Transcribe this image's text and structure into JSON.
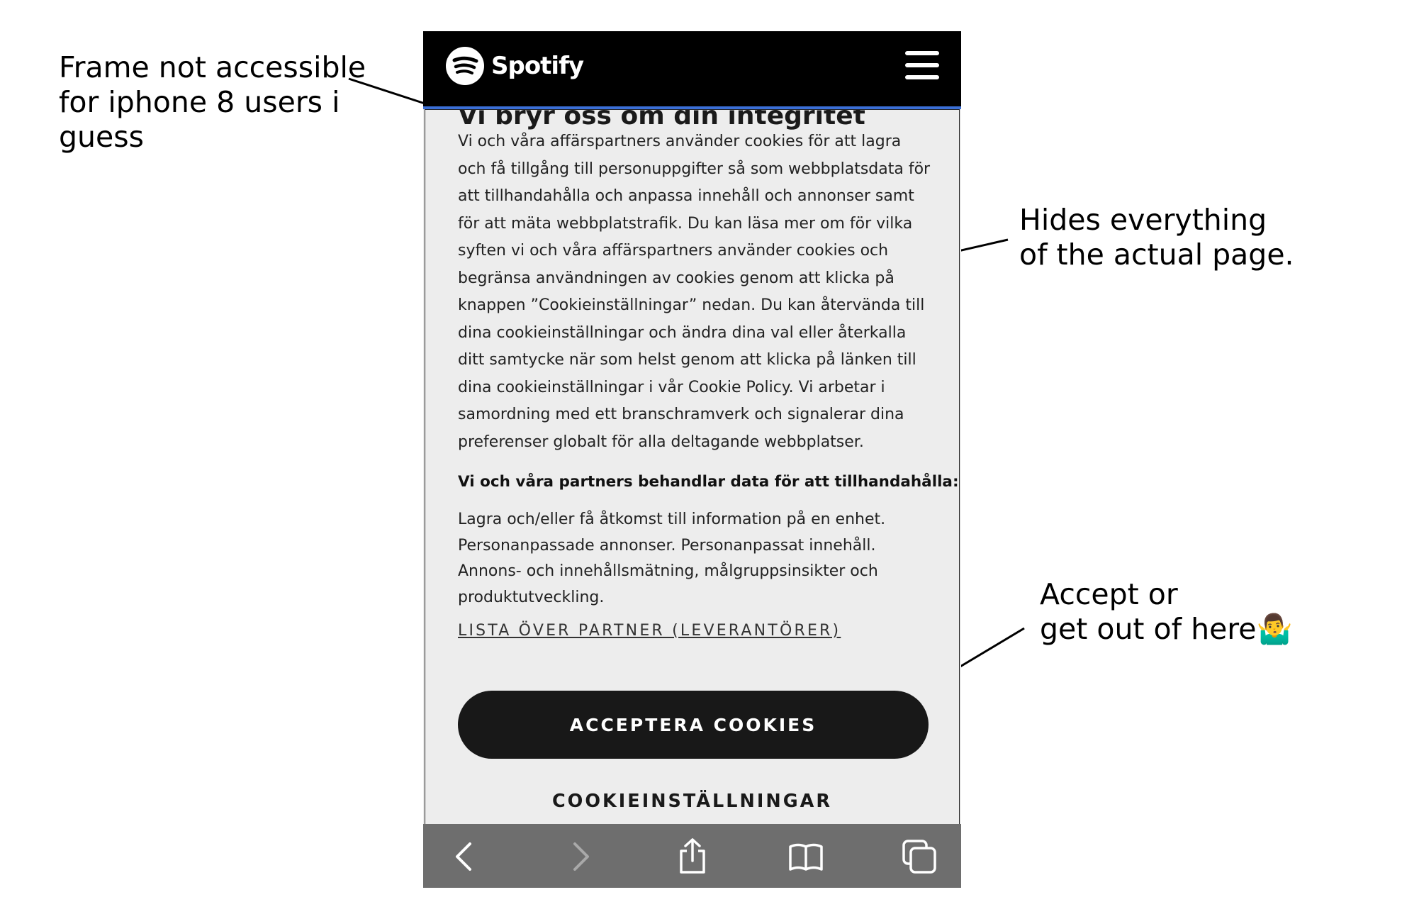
{
  "annotations": {
    "frame_note": [
      "Frame not accessible",
      "for iphone 8 users i",
      "guess"
    ],
    "hides_note": [
      "Hides everything",
      "of the actual page."
    ],
    "accept_note": [
      "Accept or",
      "get out of here🤷‍♂️"
    ]
  },
  "header": {
    "brand": "Spotify",
    "menu_icon": "hamburger-menu-icon"
  },
  "banner": {
    "title": "Vi bryr oss om din integritet",
    "body": "Vi och våra affärspartners använder cookies för att lagra och få tillgång till personuppgifter så som webbplatsdata för att tillhandahålla och anpassa innehåll och annonser samt för att mäta webbplatstrafik. Du kan läsa mer om för vilka syften vi och våra affärspartners använder cookies och begränsa användningen av cookies genom att klicka på knappen ”Cookieinställningar” nedan. Du kan återvända till dina cookieinställningar och ändra dina val eller återkalla ditt samtycke när som helst genom att klicka på länken till dina cookieinställningar i vår Cookie Policy. Vi arbetar i samordning med ett branschramverk och signalerar dina preferenser globalt för alla deltagande webbplatser.",
    "subheading": "Vi och våra partners behandlar data för att tillhandahålla:",
    "purposes": "Lagra och/eller få åtkomst till information på en enhet. Personanpassade annonser. Personanpassat innehåll. Annons- och innehållsmätning, målgruppsinsikter och produktutveckling.",
    "partner_link": "LISTA ÖVER PARTNER (LEVERANTÖRER)",
    "accept_button": "ACCEPTERA COOKIES",
    "settings_button": "COOKIEINSTÄLLNINGAR"
  },
  "toolbar": {
    "icons": [
      "back-icon",
      "forward-icon",
      "share-icon",
      "bookmarks-icon",
      "tabs-icon"
    ]
  },
  "colors": {
    "header_bg": "#000000",
    "banner_bg": "#ededed",
    "button_bg": "#181818",
    "toolbar_bg": "#6e6e6e"
  }
}
